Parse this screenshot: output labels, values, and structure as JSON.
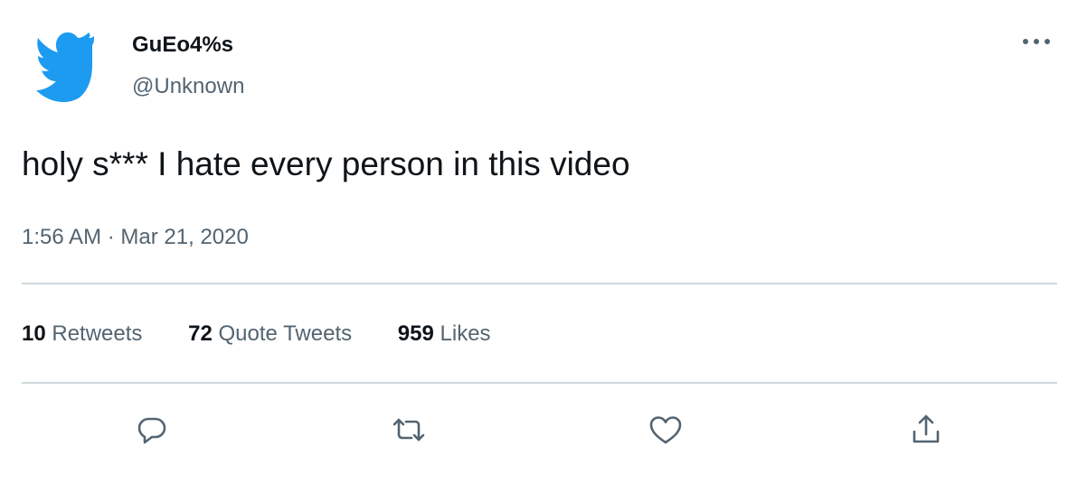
{
  "author": {
    "display_name": "GuEo4%s",
    "handle": "@Unknown"
  },
  "tweet": {
    "text": "holy s*** I hate every person in this video",
    "time": "1:56 AM",
    "separator": "·",
    "date": "Mar 21, 2020"
  },
  "stats": [
    {
      "value": "10",
      "label": "Retweets"
    },
    {
      "value": "72",
      "label": "Quote Tweets"
    },
    {
      "value": "959",
      "label": "Likes"
    }
  ],
  "icons": {
    "logo": "twitter-bird-icon",
    "more": "more-dots-icon",
    "reply": "reply-icon",
    "retweet": "retweet-icon",
    "like": "heart-icon",
    "share": "share-icon"
  },
  "colors": {
    "brand": "#1d9bf0",
    "text": "#0f1419",
    "secondary": "#536471",
    "divider": "#cfd9de"
  }
}
